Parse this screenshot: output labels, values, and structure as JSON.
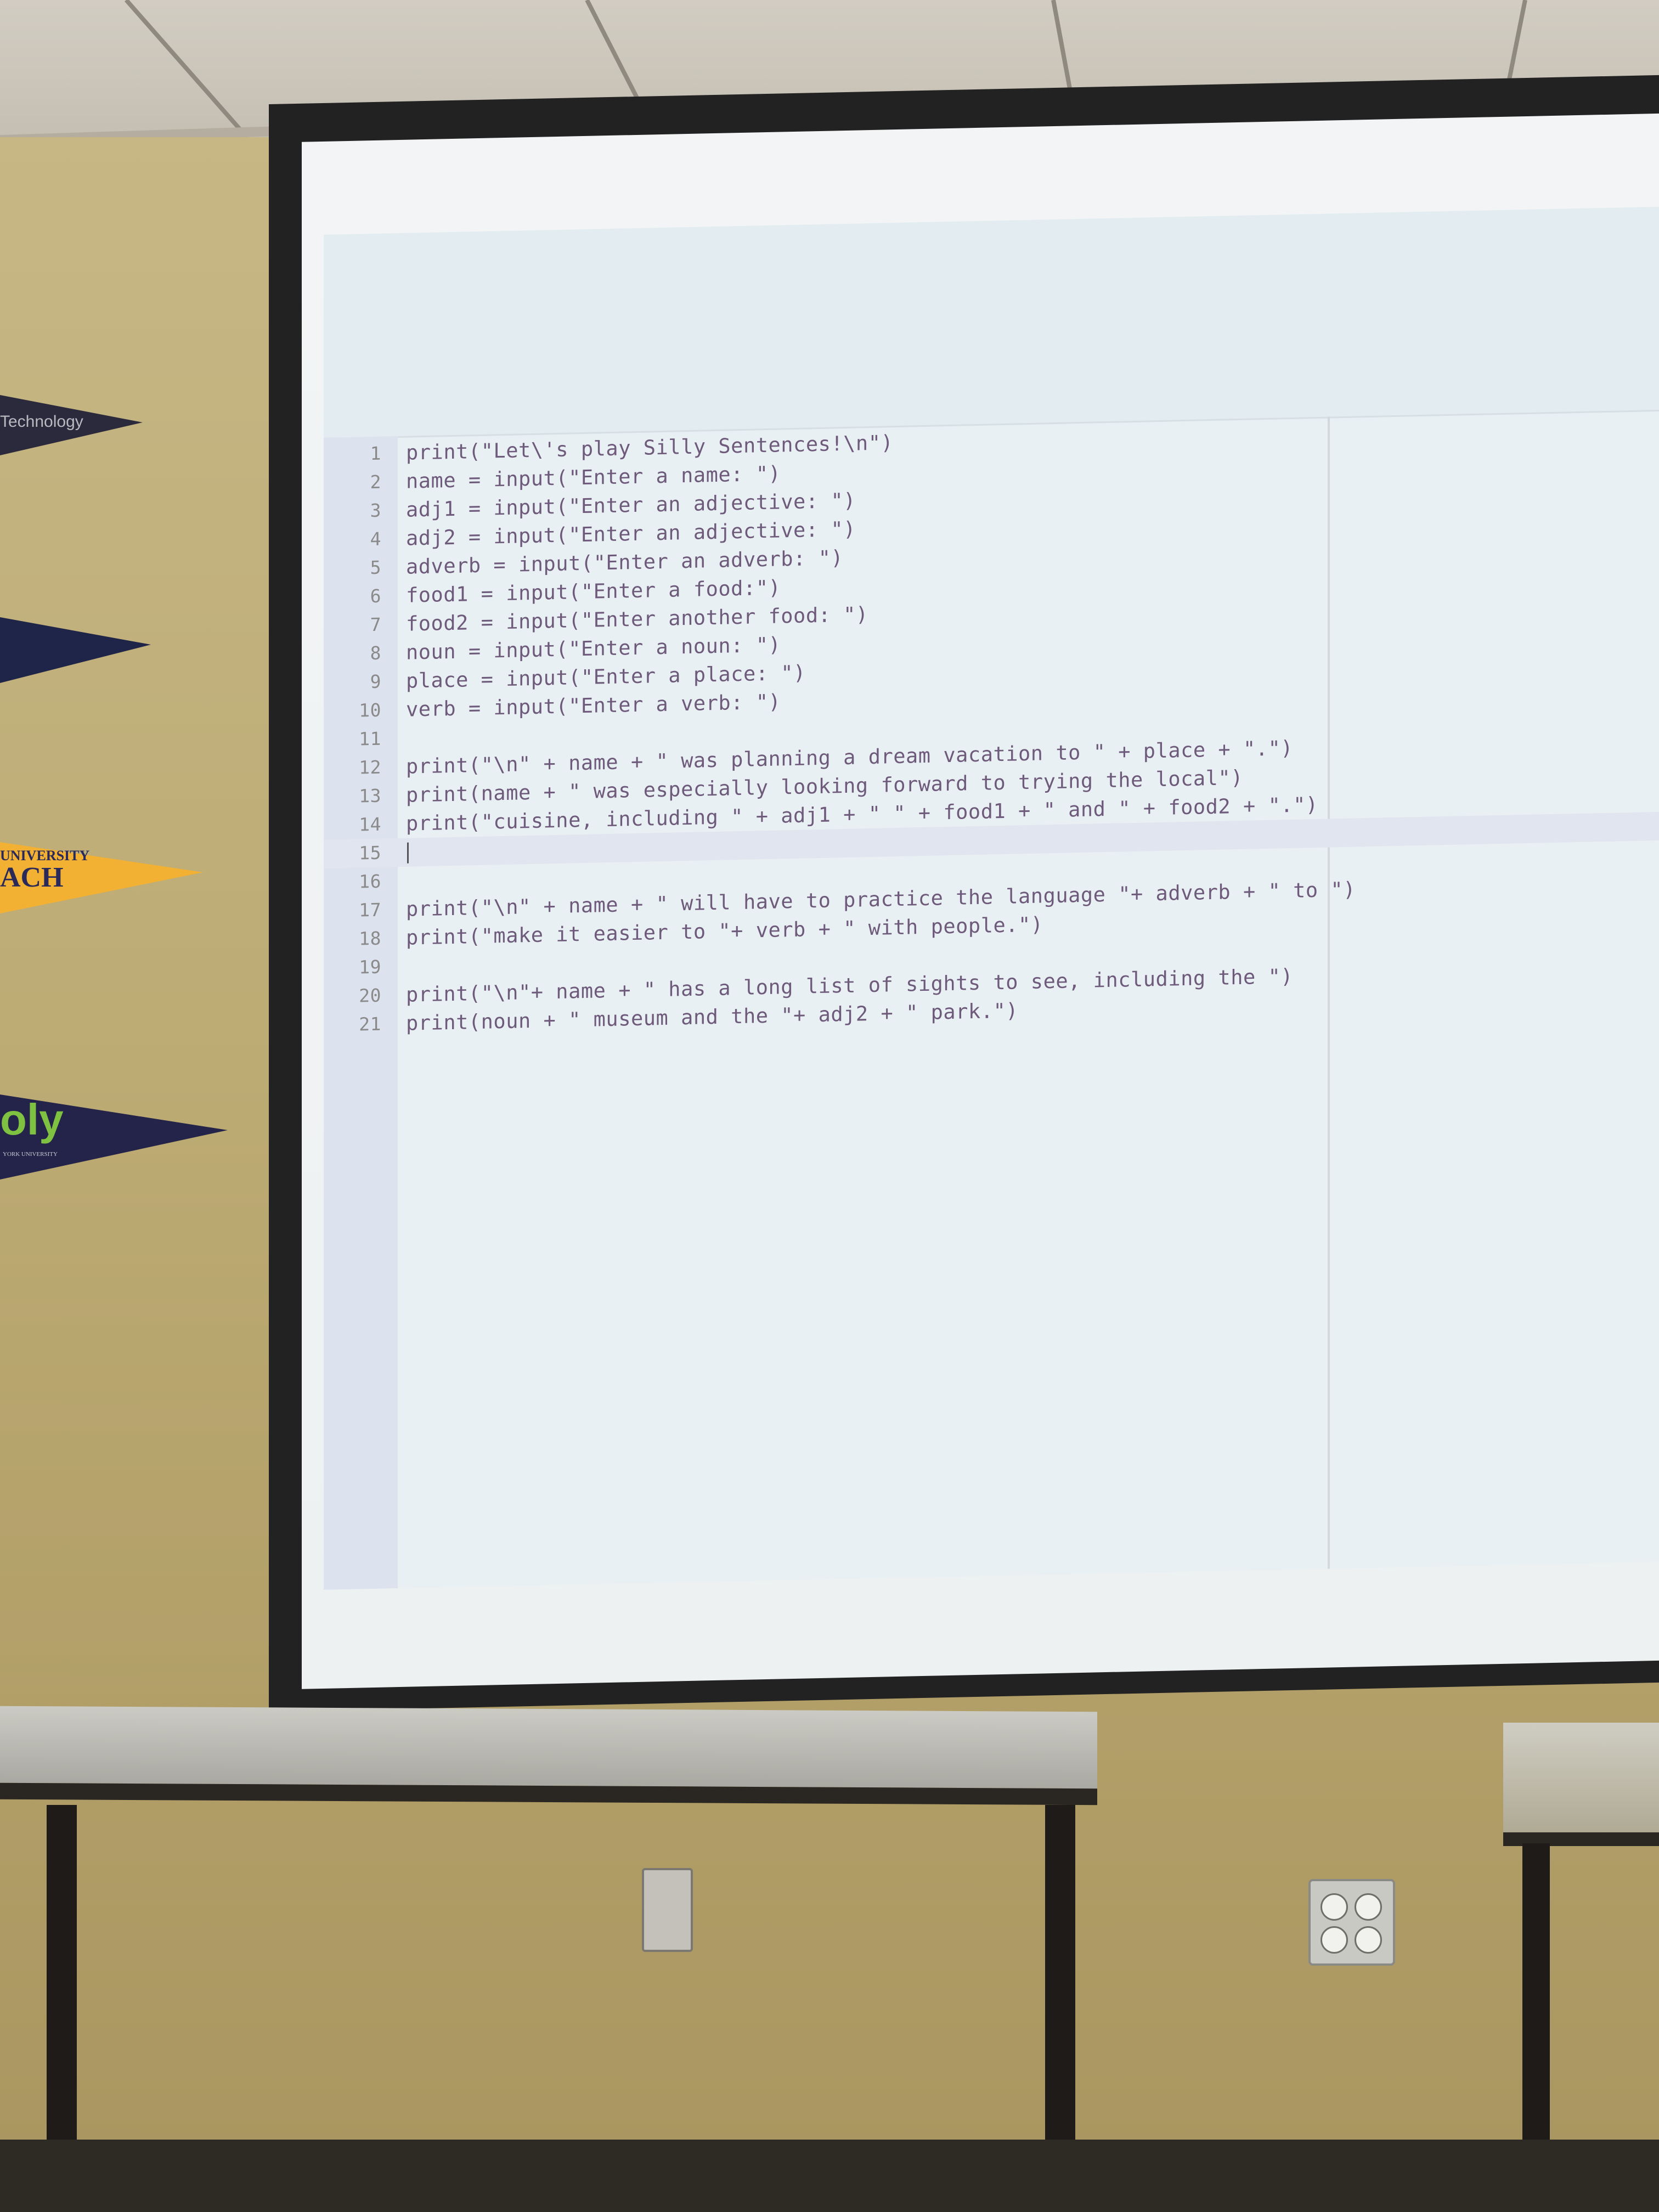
{
  "pennants": [
    {
      "label": "Technology",
      "color": "#2b2a3d",
      "text_color": "#b9b9c2"
    },
    {
      "label": "",
      "color": "#1f2548"
    },
    {
      "label": "UNIVERSITY",
      "sub": "ACH",
      "color": "#f2b132",
      "text_color": "#2a2a5a"
    },
    {
      "label": "oly",
      "sub": "YORK UNIVERSITY",
      "color": "#24244a",
      "text_color": "#7fc241"
    }
  ],
  "editor": {
    "lines": [
      {
        "num": "1",
        "code": "print(\"Let\\'s play Silly Sentences!\\n\")"
      },
      {
        "num": "2",
        "code": "name = input(\"Enter a name: \")"
      },
      {
        "num": "3",
        "code": "adj1 = input(\"Enter an adjective: \")"
      },
      {
        "num": "4",
        "code": "adj2 = input(\"Enter an adjective: \")"
      },
      {
        "num": "5",
        "code": "adverb = input(\"Enter an adverb: \")"
      },
      {
        "num": "6",
        "code": "food1 = input(\"Enter a food:\")"
      },
      {
        "num": "7",
        "code": "food2 = input(\"Enter another food: \")"
      },
      {
        "num": "8",
        "code": "noun = input(\"Enter a noun: \")"
      },
      {
        "num": "9",
        "code": "place = input(\"Enter a place: \")"
      },
      {
        "num": "10",
        "code": "verb = input(\"Enter a verb: \")"
      },
      {
        "num": "11",
        "code": ""
      },
      {
        "num": "12",
        "code": "print(\"\\n\" + name + \" was planning a dream vacation to \" + place + \".\")"
      },
      {
        "num": "13",
        "code": "print(name + \" was especially looking forward to trying the local\")"
      },
      {
        "num": "14",
        "code": "print(\"cuisine, including \" + adj1 + \" \" + food1 + \" and \" + food2 + \".\")"
      },
      {
        "num": "15",
        "code": ""
      },
      {
        "num": "16",
        "code": ""
      },
      {
        "num": "17",
        "code": "print(\"\\n\" + name + \" will have to practice the language \"+ adverb + \" to \")"
      },
      {
        "num": "18",
        "code": "print(\"make it easier to \"+ verb + \" with people.\")"
      },
      {
        "num": "19",
        "code": ""
      },
      {
        "num": "20",
        "code": "print(\"\\n\"+ name + \" has a long list of sights to see, including the \")"
      },
      {
        "num": "21",
        "code": "print(noun + \" museum and the \"+ adj2 + \" park.\")"
      }
    ],
    "current_line": "15"
  }
}
